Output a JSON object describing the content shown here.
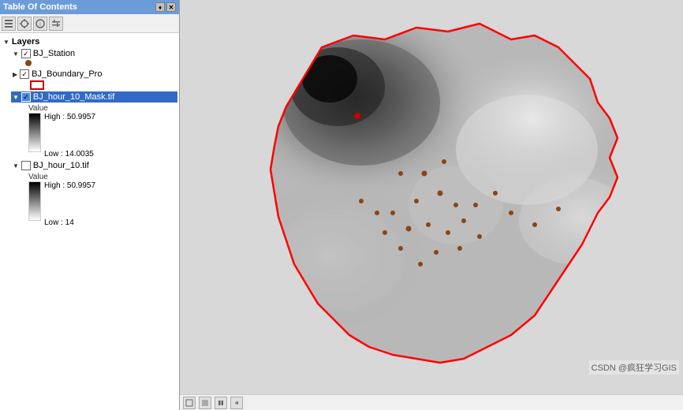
{
  "toc": {
    "title": "Table Of Contents",
    "pin_label": "♦",
    "close_label": "✕",
    "toolbar_buttons": [
      "layers_icon",
      "refresh_icon",
      "options_icon",
      "filter_icon"
    ],
    "layers_header": "Layers",
    "layers": [
      {
        "name": "BJ_Station",
        "checked": true,
        "expanded": true,
        "selected": false,
        "type": "point",
        "children": []
      },
      {
        "name": "BJ_Boundary_Pro",
        "checked": true,
        "expanded": false,
        "selected": false,
        "type": "polygon",
        "children": []
      },
      {
        "name": "BJ_hour_10_Mask.tif",
        "checked": true,
        "expanded": true,
        "selected": true,
        "type": "raster",
        "legend": {
          "value_label": "Value",
          "high_label": "High : 50.9957",
          "low_label": "Low : 14.0035"
        }
      },
      {
        "name": "BJ_hour_10.tif",
        "checked": false,
        "expanded": true,
        "selected": false,
        "type": "raster",
        "legend": {
          "value_label": "Value",
          "high_label": "High : 50.9957",
          "low_label": "Low : 14"
        }
      }
    ]
  },
  "status": {
    "watermark": "CSDN @疯狂学习GIS"
  }
}
